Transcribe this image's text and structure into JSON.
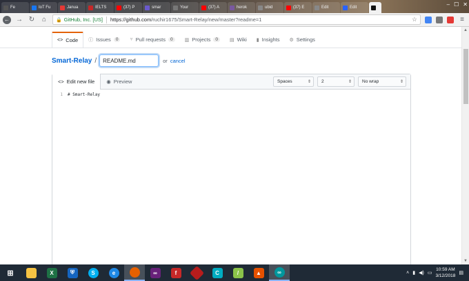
{
  "browser": {
    "tabs": [
      {
        "label": "Fe",
        "color": "#555"
      },
      {
        "label": "IoT Fu",
        "color": "#1877f2"
      },
      {
        "label": "Janua",
        "color": "#e53935"
      },
      {
        "label": "IELTS",
        "color": "#c62828"
      },
      {
        "label": "(37) P",
        "color": "#ff0000"
      },
      {
        "label": "smar",
        "color": "#6a5acd"
      },
      {
        "label": "Your",
        "color": "#777"
      },
      {
        "label": "(37) A",
        "color": "#ff0000"
      },
      {
        "label": "herok",
        "color": "#79589f"
      },
      {
        "label": "ubid",
        "color": "#888"
      },
      {
        "label": "(37) E",
        "color": "#ff0000"
      },
      {
        "label": "Edit",
        "color": "#888"
      },
      {
        "label": "Edit",
        "color": "#2962ff"
      },
      {
        "label": "",
        "color": "#111",
        "active": true
      }
    ],
    "secure_label": "GitHub, Inc. [US]",
    "url_host": "https://github.com",
    "url_path": "/ruchir1675/Smart-Relay/new/master?readme=1"
  },
  "repo_nav": {
    "code": "Code",
    "issues": "Issues",
    "issues_count": "0",
    "pulls": "Pull requests",
    "pulls_count": "0",
    "projects": "Projects",
    "projects_count": "0",
    "wiki": "Wiki",
    "insights": "Insights",
    "settings": "Settings"
  },
  "breadcrumb": {
    "repo": "Smart-Relay",
    "slash": "/",
    "filename": "README.md",
    "or_text": "or",
    "cancel": "cancel"
  },
  "editor": {
    "tab_edit": "Edit new file",
    "tab_preview": "Preview",
    "indent_mode": "Spaces",
    "indent_size": "2",
    "wrap_mode": "No wrap",
    "lines": [
      {
        "num": "1",
        "text": "# Smart-Relay"
      }
    ]
  },
  "taskbar": {
    "time": "10:59 AM",
    "date": "3/12/2018"
  }
}
